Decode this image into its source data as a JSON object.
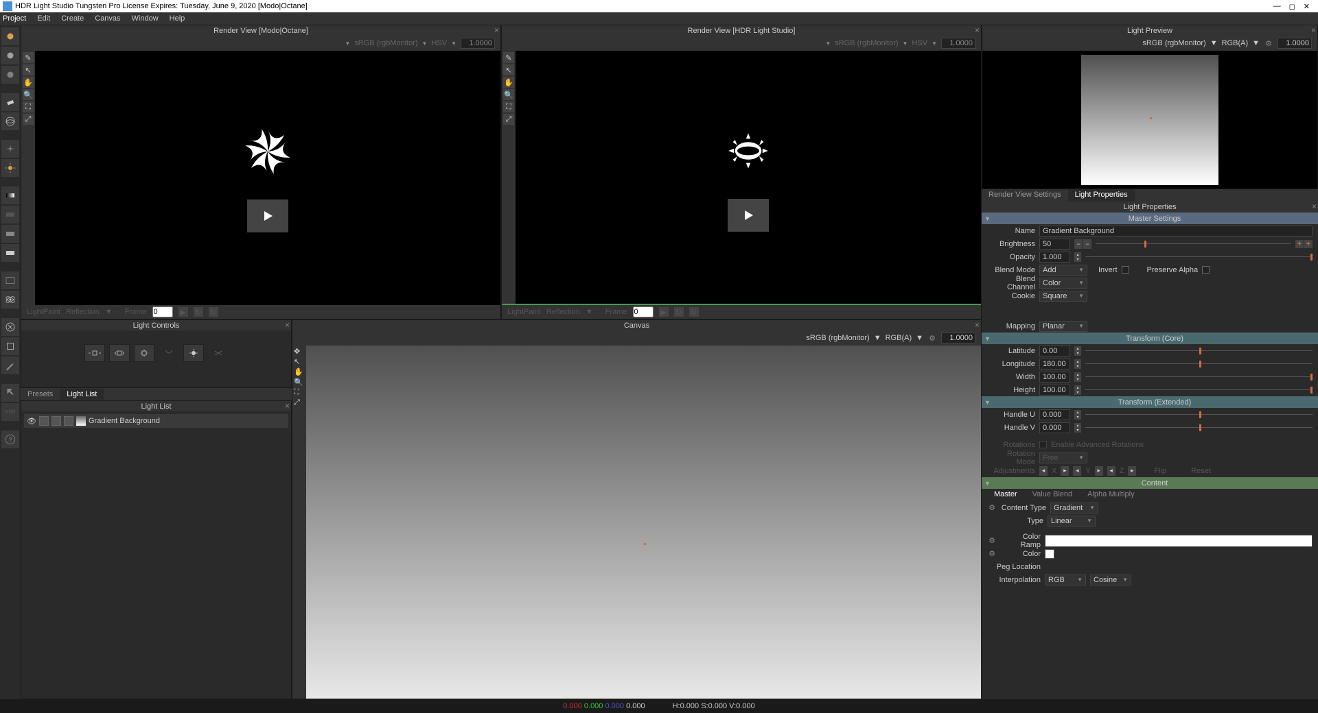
{
  "title": "HDR Light Studio Tungsten Pro License Expires: Tuesday, June 9, 2020  [Modo|Octane]",
  "menu": [
    "Project",
    "Edit",
    "Create",
    "Canvas",
    "Window",
    "Help"
  ],
  "panels": {
    "render1": {
      "title": "Render View [Modo|Octane]",
      "colorspace": "sRGB (rgbMonitor)",
      "mode": "HSV",
      "value": "1.0000",
      "footer": {
        "lightpaint": "LightPaint",
        "reflection": "Reflection",
        "frame": "Frame",
        "fval": "0"
      }
    },
    "render2": {
      "title": "Render View [HDR Light Studio]",
      "colorspace": "sRGB (rgbMonitor)",
      "mode": "HSV",
      "value": "1.0000",
      "footer": {
        "lightpaint": "LightPaint",
        "reflection": "Reflection",
        "frame": "Frame",
        "fval": "0"
      }
    },
    "lightpreview": {
      "title": "Light Preview",
      "colorspace": "sRGB (rgbMonitor)",
      "mode": "RGB(A)",
      "value": "1.0000"
    },
    "lightcontrols": {
      "title": "Light Controls"
    },
    "canvas": {
      "title": "Canvas",
      "colorspace": "sRGB (rgbMonitor)",
      "mode": "RGB(A)",
      "value": "1.0000"
    }
  },
  "lower_tabs": {
    "presets": "Presets",
    "lightlist": "Light List"
  },
  "lightlist": {
    "title": "Light List",
    "item": "Gradient Background"
  },
  "prop_tabs": {
    "rvs": "Render View Settings",
    "lp": "Light Properties"
  },
  "props": {
    "header": "Light Properties",
    "master": {
      "title": "Master Settings",
      "name_lbl": "Name",
      "name": "Gradient Background",
      "brightness_lbl": "Brightness",
      "brightness": "50",
      "opacity_lbl": "Opacity",
      "opacity": "1.000",
      "blendmode_lbl": "Blend Mode",
      "blendmode": "Add",
      "invert": "Invert",
      "preserve": "Preserve Alpha",
      "blendchannel_lbl": "Blend Channel",
      "blendchannel": "Color",
      "cookie_lbl": "Cookie",
      "cookie": "Square",
      "mapping_lbl": "Mapping",
      "mapping": "Planar"
    },
    "tcore": {
      "title": "Transform (Core)",
      "lat_lbl": "Latitude",
      "lat": "0.00",
      "lon_lbl": "Longitude",
      "lon": "180.00",
      "width_lbl": "Width",
      "width": "100.00",
      "height_lbl": "Height",
      "height": "100.00"
    },
    "text": {
      "title": "Transform (Extended)",
      "hu_lbl": "Handle U",
      "hu": "0.000",
      "hv_lbl": "Handle V",
      "hv": "0.000",
      "rotations_lbl": "Rotations",
      "rotations_chk": "Enable Advanced Rotations",
      "rotmode_lbl": "Rotation Mode",
      "rotmode": "Free",
      "adj_lbl": "Adjustments",
      "x": "X",
      "y": "Y",
      "z": "Z",
      "flip": "Flip",
      "reset": "Reset"
    },
    "content": {
      "title": "Content",
      "tabs": {
        "master": "Master",
        "value": "Value Blend",
        "alpha": "Alpha Multiply"
      },
      "ctype_lbl": "Content Type",
      "ctype": "Gradient",
      "type_lbl": "Type",
      "type": "Linear",
      "ramp_lbl": "Color Ramp",
      "color_lbl": "Color",
      "peg_lbl": "Peg Location",
      "interp_lbl": "Interpolation",
      "interp1": "RGB",
      "interp2": "Cosine"
    }
  },
  "statusbar": {
    "r": "0.000",
    "g": "0.000",
    "b": "0.000",
    "a": "0.000",
    "hsv": "H:0.000 S:0.000 V:0.000"
  }
}
